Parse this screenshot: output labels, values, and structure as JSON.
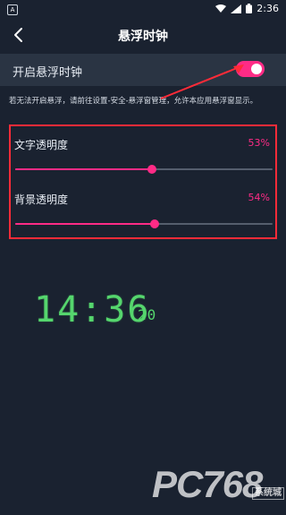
{
  "status_bar": {
    "time": "2:36"
  },
  "app_bar": {
    "title": "悬浮时钟"
  },
  "floating_clock": {
    "toggle_label": "开启悬浮时钟",
    "enabled": true
  },
  "hint": {
    "text": "若无法开启悬浮，请前往设置-安全-悬浮窗管理，允许本应用悬浮窗显示。"
  },
  "sliders": [
    {
      "label": "文字透明度",
      "value_text": "53%",
      "value": 53
    },
    {
      "label": "背景透明度",
      "value_text": "54%",
      "value": 54
    }
  ],
  "clock_preview": {
    "hours_minutes": "14:36",
    "seconds": "20"
  },
  "watermark": {
    "brand": "PC768",
    "sub": "系统城"
  },
  "colors": {
    "accent": "#ff2b86",
    "highlight_box": "#ff2b38",
    "background": "#1a2230",
    "clock": "#55d66d"
  }
}
